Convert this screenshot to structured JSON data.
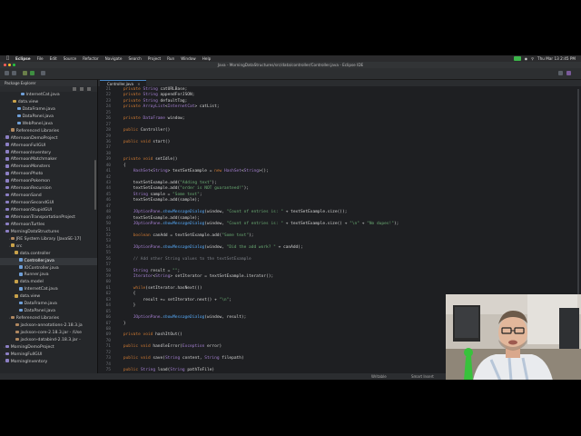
{
  "menubar": {
    "apple": "",
    "app_name": "Eclipse",
    "items": [
      "File",
      "Edit",
      "Source",
      "Refactor",
      "Navigate",
      "Search",
      "Project",
      "Run",
      "Window",
      "Help"
    ],
    "clock": "Thu Mar 13  2:45 PM"
  },
  "window": {
    "title": "Java - MorningDataStructures/src/data/controller/Controller.java - Eclipse IDE"
  },
  "package_explorer": {
    "title": "Package Explorer",
    "rows": [
      {
        "label": "InternetCat.java",
        "type": "file"
      },
      {
        "label": "data.view",
        "type": "package"
      },
      {
        "label": "DataFrame.java",
        "type": "file"
      },
      {
        "label": "DataPanel.java",
        "type": "file"
      },
      {
        "label": "WebPanel.java",
        "type": "file"
      },
      {
        "label": "Referenced Libraries",
        "type": "lib"
      },
      {
        "label": "AfternoonDemoProject",
        "type": "project"
      },
      {
        "label": "AfternoonFullGUI",
        "type": "project"
      },
      {
        "label": "AfternoonInventory",
        "type": "project"
      },
      {
        "label": "AfternoonMatchmaker",
        "type": "project"
      },
      {
        "label": "AfternoonMonsters",
        "type": "project"
      },
      {
        "label": "AfternoonPhoto",
        "type": "project"
      },
      {
        "label": "AfternoonPokemon",
        "type": "project"
      },
      {
        "label": "AfternoonRecursion",
        "type": "project"
      },
      {
        "label": "AfternoonSand",
        "type": "project"
      },
      {
        "label": "AfternoonSecondGUI",
        "type": "project"
      },
      {
        "label": "AfternoonStupidGUI",
        "type": "project"
      },
      {
        "label": "AfternoonTransportationProject",
        "type": "project"
      },
      {
        "label": "AfternoonTurtles",
        "type": "project"
      },
      {
        "label": "MorningDataStructures",
        "type": "project"
      },
      {
        "label": "JRE System Library [JavaSE-17]",
        "type": "lib"
      },
      {
        "label": "src",
        "type": "folder"
      },
      {
        "label": "data.controller",
        "type": "package"
      },
      {
        "label": "Controller.java",
        "type": "file",
        "selected": true
      },
      {
        "label": "IOController.java",
        "type": "file"
      },
      {
        "label": "Runner.java",
        "type": "file"
      },
      {
        "label": "data.model",
        "type": "package"
      },
      {
        "label": "InternetCat.java",
        "type": "file"
      },
      {
        "label": "data.view",
        "type": "package"
      },
      {
        "label": "DataFrame.java",
        "type": "file"
      },
      {
        "label": "DataPanel.java",
        "type": "file"
      },
      {
        "label": "Referenced Libraries",
        "type": "lib"
      },
      {
        "label": "jackson-annotations-2.18.3.ja",
        "type": "jar"
      },
      {
        "label": "jackson-core-2.18.3.jar - /Use",
        "type": "jar"
      },
      {
        "label": "jackson-databind-2.18.3.jar -",
        "type": "jar"
      },
      {
        "label": "MorningDemoProject",
        "type": "project"
      },
      {
        "label": "MorningFullGUI",
        "type": "project"
      },
      {
        "label": "MorningInventory",
        "type": "project"
      }
    ]
  },
  "editor": {
    "tab_label": "Controller.java",
    "lines": [
      {
        "n": "21",
        "t": "    private String catURLBase;"
      },
      {
        "n": "22",
        "t": "    private String appendForJSON;"
      },
      {
        "n": "23",
        "t": "    private String defaultTag;"
      },
      {
        "n": "24",
        "t": "    private ArrayList<InternetCat> catList;"
      },
      {
        "n": "25",
        "t": ""
      },
      {
        "n": "26",
        "t": "    private DataFrame window;"
      },
      {
        "n": "27",
        "t": ""
      },
      {
        "n": "28",
        "t": "    public Controller()"
      },
      {
        "n": "29",
        "t": ""
      },
      {
        "n": "36",
        "t": "    public void start()"
      },
      {
        "n": "37",
        "t": ""
      },
      {
        "n": "38",
        "t": ""
      },
      {
        "n": "39",
        "t": "    private void setIdle()"
      },
      {
        "n": "40",
        "t": "    {"
      },
      {
        "n": "41",
        "t": "        HashSet<String> textSetExample = new HashSet<String>();"
      },
      {
        "n": "42",
        "t": ""
      },
      {
        "n": "43",
        "t": "        textSetExample.add(\"Adding text\");"
      },
      {
        "n": "44",
        "t": "        textSetExample.add(\"order is NOT guaranteed!\");"
      },
      {
        "n": "45",
        "t": "        String sample = \"Some text\";"
      },
      {
        "n": "46",
        "t": "        textSetExample.add(sample);"
      },
      {
        "n": "47",
        "t": ""
      },
      {
        "n": "48",
        "t": "        JOptionPane.showMessageDialog(window, \"Count of entries is: \" + textSetExample.size());"
      },
      {
        "n": "49",
        "t": "        textSetExample.add(sample);"
      },
      {
        "n": "50",
        "t": "        JOptionPane.showMessageDialog(window, \"Count of entries is: \" + textSetExample.size() + \"\\n\" + \"No dupes!\");"
      },
      {
        "n": "51",
        "t": ""
      },
      {
        "n": "52",
        "t": "        boolean canAdd = textSetExample.add(\"Some text\");"
      },
      {
        "n": "53",
        "t": ""
      },
      {
        "n": "54",
        "t": "        JOptionPane.showMessageDialog(window, \"Did the add work? \" + canAdd);"
      },
      {
        "n": "55",
        "t": ""
      },
      {
        "n": "56",
        "t": "        // Add other String values to the textSetExample"
      },
      {
        "n": "57",
        "t": ""
      },
      {
        "n": "58",
        "t": "        String result = \"\";"
      },
      {
        "n": "59",
        "t": "        Iterator<String> setIterator = textSetExample.iterator();"
      },
      {
        "n": "60",
        "t": ""
      },
      {
        "n": "61",
        "t": "        while(setIterator.hasNext())"
      },
      {
        "n": "62",
        "t": "        {"
      },
      {
        "n": "63",
        "t": "            result += setIterator.next() + \"\\n\";"
      },
      {
        "n": "64",
        "t": "        }"
      },
      {
        "n": "65",
        "t": ""
      },
      {
        "n": "66",
        "t": "        JOptionPane.showMessageDialog(window, result);"
      },
      {
        "n": "67",
        "t": "    }"
      },
      {
        "n": "68",
        "t": ""
      },
      {
        "n": "69",
        "t": "    private void hashItOut()"
      },
      {
        "n": "70",
        "t": ""
      },
      {
        "n": "71",
        "t": "    public void handleError(Exception error)"
      },
      {
        "n": "72",
        "t": ""
      },
      {
        "n": "73",
        "t": "    public void save(String content, String filepath)"
      },
      {
        "n": "74",
        "t": ""
      },
      {
        "n": "75",
        "t": "    public String load(String pathToFile)"
      }
    ]
  },
  "status": {
    "writable": "Writable",
    "insert": "Smart Insert"
  },
  "colors": {
    "background": "#1e1f22",
    "keyword": "#cc7832",
    "string": "#6aab73",
    "comment": "#7a7e85",
    "selection": "#34373b",
    "status_green": "#3bb54a"
  }
}
